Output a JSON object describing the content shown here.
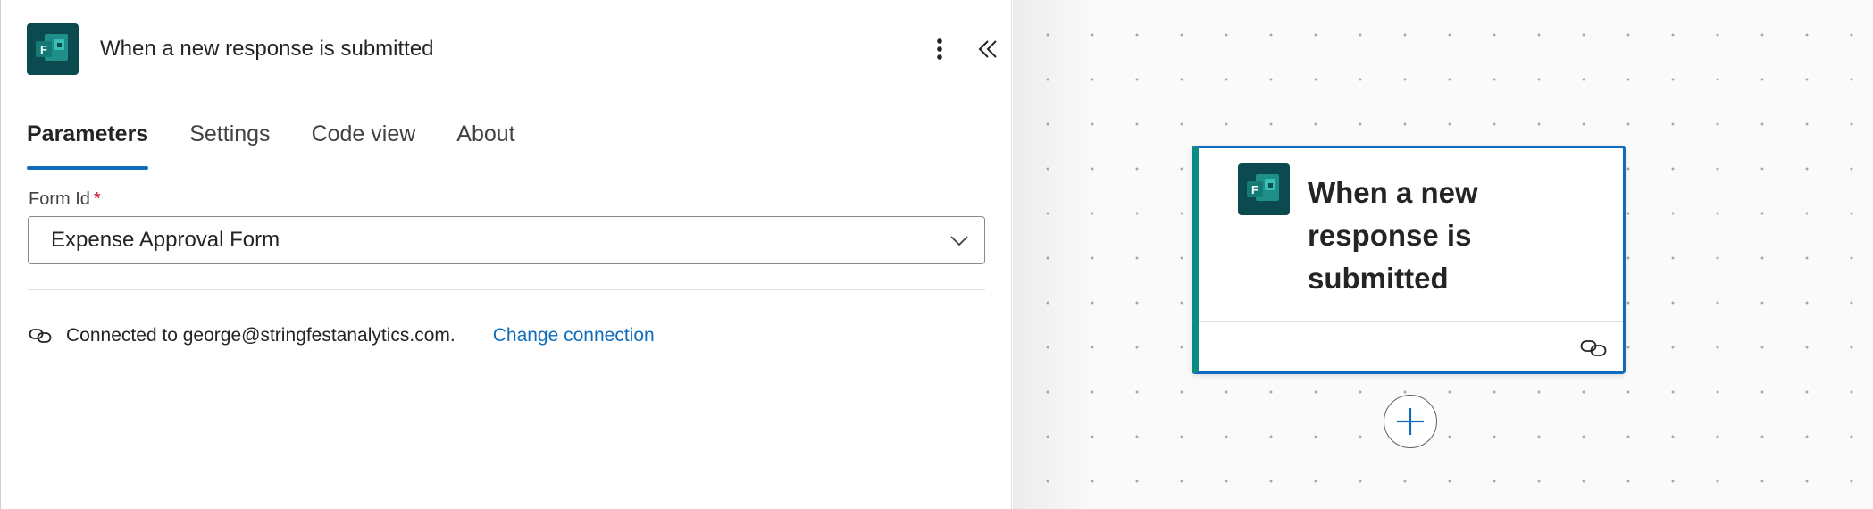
{
  "panel": {
    "title": "When a new response is submitted",
    "app_icon": "microsoft-forms-icon",
    "tabs": [
      {
        "label": "Parameters",
        "active": true
      },
      {
        "label": "Settings",
        "active": false
      },
      {
        "label": "Code view",
        "active": false
      },
      {
        "label": "About",
        "active": false
      }
    ],
    "form_id": {
      "label": "Form Id",
      "required_marker": "*",
      "value": "Expense Approval Form"
    },
    "connection": {
      "text": "Connected to george@stringfestanalytics.com.",
      "change_label": "Change connection"
    }
  },
  "canvas": {
    "card": {
      "title": "When a new response is submitted",
      "selected": true
    }
  },
  "colors": {
    "accent": "#0f6cbd",
    "forms_icon_bg": "#0b4a4f",
    "card_left_bar": "#0b8a86"
  }
}
